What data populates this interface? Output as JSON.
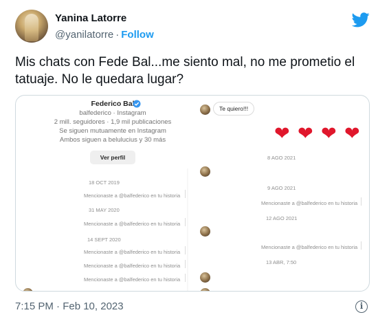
{
  "tweet": {
    "author_name": "Yanina Latorre",
    "author_handle": "@yanilatorre",
    "separator": "·",
    "follow_label": "Follow",
    "text": "Mis chats con Fede Bal...me siento mal, no me prometio el tatuaje. No le quedara lugar?",
    "timestamp": "7:15 PM · Feb 10, 2023",
    "brand_color": "#1d9bf0",
    "icons": [
      "twitter-bird-icon",
      "info-icon"
    ]
  },
  "screenshot": {
    "profile": {
      "name": "Federico Bal",
      "username": "balfederico · Instagram",
      "stats": "2 mill. seguidores · 1,9 mil publicaciones",
      "mutual": "Se siguen mutuamente en Instagram",
      "common": "Ambos siguen a belulucius y 30 más",
      "button": "Ver perfil"
    },
    "message": "Te quiero!!!",
    "hearts": [
      "❤",
      "❤",
      "❤",
      "❤"
    ],
    "left_events": [
      {
        "date": "18 OCT 2019",
        "note": "Mencionaste a @balfederico en tu historia"
      },
      {
        "date": "31 MAY 2020",
        "note": "Mencionaste a @balfederico en tu historia"
      },
      {
        "date": "14 SEPT 2020",
        "note": "Mencionaste a @balfederico en tu historia"
      }
    ],
    "left_extra_notes": [
      "Mencionaste a @balfederico en tu historia",
      "Mencionaste a @balfederico en tu historia"
    ],
    "right_dates": [
      "8 AGO 2021",
      "9 AGO 2021",
      "12 AGO 2021",
      "13 ABR, 7:50"
    ],
    "right_notes": [
      "Mencionaste a @balfederico en tu historia",
      "Mencionaste a @balfederico en tu historia"
    ]
  }
}
